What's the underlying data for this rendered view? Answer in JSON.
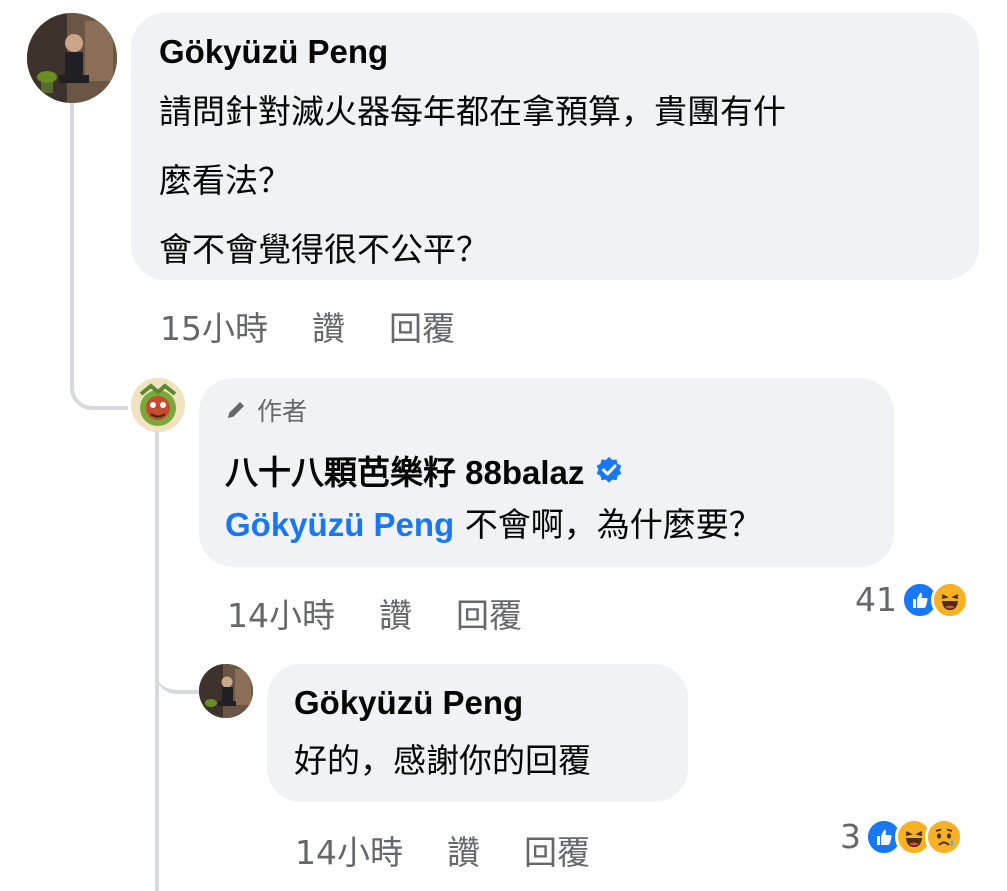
{
  "comments": [
    {
      "author": "Gökyüzü Peng",
      "lines": [
        "請問針對滅火器每年都在拿預算，貴團有什",
        "麼看法？",
        "會不會覺得很不公平？"
      ],
      "time": "15小時",
      "like_label": "讚",
      "reply_label": "回覆"
    },
    {
      "badge": "作者",
      "author": "八十八顆芭樂籽 88balaz",
      "verified": true,
      "mention": "Gökyüzü Peng",
      "text": " 不會啊，為什麼要？",
      "time": "14小時",
      "like_label": "讚",
      "reply_label": "回覆",
      "reaction_count": "41",
      "reactions": [
        "like-icon",
        "haha-icon"
      ]
    },
    {
      "author": "Gökyüzü Peng",
      "text": "好的，感謝你的回覆",
      "time": "14小時",
      "like_label": "讚",
      "reply_label": "回覆",
      "reaction_count": "3",
      "reactions": [
        "like-icon",
        "haha-icon",
        "sad-icon"
      ]
    }
  ],
  "colors": {
    "bubble": "#f0f2f5",
    "link": "#1877f2",
    "meta": "#65676b"
  }
}
